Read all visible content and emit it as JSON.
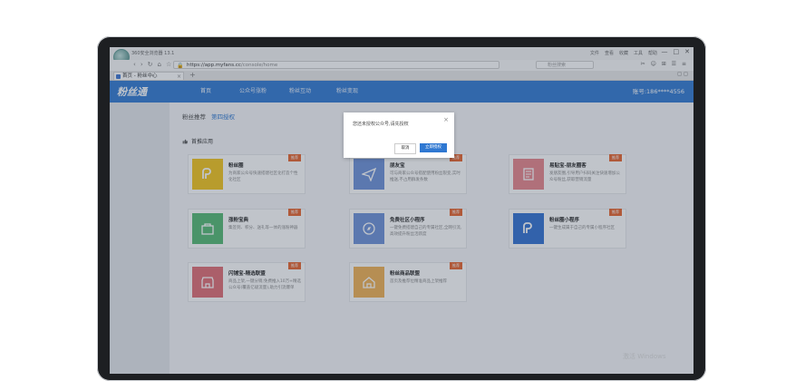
{
  "browser": {
    "window_title": "360安全浏览器 13.1",
    "menu": [
      "文件",
      "查看",
      "收藏",
      "工具",
      "帮助"
    ],
    "window_controls": [
      "—",
      "□",
      "✕"
    ],
    "nav_buttons": [
      "‹",
      "›",
      "↻",
      "⌂",
      "☆"
    ],
    "url_main": "https://app.myfans.cc",
    "url_tail": "/console/home",
    "search_placeholder": "粉丝搜索",
    "toolbar_icons": "✂ ☺ ⊞ ☰ ≡",
    "tab_label": "首页 - 粉丝中心",
    "tab_close": "×",
    "tab_add": "+",
    "tab_right_icons": "◻ ◻"
  },
  "app": {
    "logo": "粉丝通",
    "menu": [
      {
        "label": "首页"
      },
      {
        "label": "公众号涨粉"
      },
      {
        "label": "粉丝互动"
      },
      {
        "label": "粉丝变现"
      }
    ],
    "account": "账号:186****4556"
  },
  "content": {
    "breadcrumb_root": "粉丝推荐",
    "breadcrumb_link": "第四授权",
    "section_title": "首推应用",
    "cards": [
      {
        "title": "粉丝圈",
        "desc": "为商家公众号快速搭建社区化打造个性化社区",
        "tag": "推荐",
        "color": "#f3c419",
        "icon": "tag-p-icon"
      },
      {
        "title": "朋友宝",
        "desc": "可与商家公众号搭配使用粉丝裂变,实时推送,不占用群发条数",
        "tag": "推荐",
        "color": "#6a8fd8",
        "icon": "paper-plane-icon"
      },
      {
        "title": "易贴宝-朋友圈客",
        "desc": "发朋友圈,引导用户扫码关注快速增加公众号粉丝,获取营销流量",
        "tag": "推荐",
        "color": "#e8838a",
        "icon": "scroll-icon"
      },
      {
        "title": "涨粉宝典",
        "desc": "集签到、积分、送礼等一体的涨粉神器",
        "tag": "推荐",
        "color": "#52b870",
        "icon": "bag-icon"
      },
      {
        "title": "免费社区小程序",
        "desc": "一键免费搭建自己的专属社区,全网引流,高效提升粉丝活跃度",
        "tag": "推荐",
        "color": "#6a8fd8",
        "icon": "compass-icon"
      },
      {
        "title": "粉丝圈小程序",
        "desc": "一键生成属于自己的专属小程序社区",
        "tag": "推荐",
        "color": "#2f6fd1",
        "icon": "tag-p-icon"
      },
      {
        "title": "闪铺宝-精选联盟",
        "desc": "商品上架,一键分销;免费推入10万+精选公众号(覆盖亿级流量),助力引流爆单",
        "tag": "推荐",
        "color": "#e06b72",
        "icon": "store-icon"
      },
      {
        "title": "粉丝商品联盟",
        "desc": "首页及推荐位精准商品上架推荐",
        "tag": "推荐",
        "color": "#f0b050",
        "icon": "home-icon"
      }
    ]
  },
  "dialog": {
    "message": "您还未授权公众号,请先授权",
    "close": "×",
    "cancel": "取消",
    "confirm": "立即授权"
  },
  "watermark": "激活 Windows"
}
